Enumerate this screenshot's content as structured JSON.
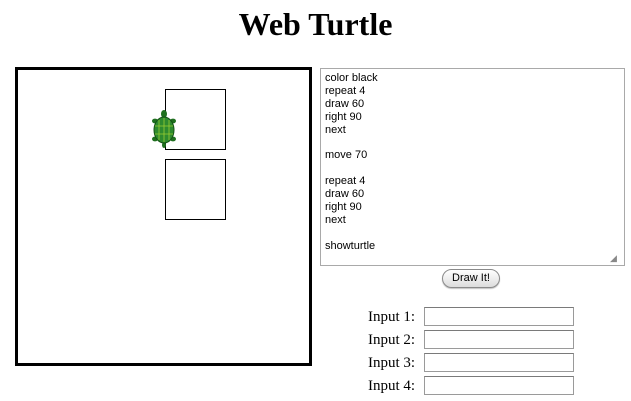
{
  "page": {
    "title": "Web Turtle"
  },
  "editor": {
    "code": "color black\nrepeat 4\ndraw 60\nright 90\nnext\n\nmove 70\n\nrepeat 4\ndraw 60\nright 90\nnext\n\nshowturtle"
  },
  "draw_button": {
    "label": "Draw It!"
  },
  "inputs": [
    {
      "label": "Input 1:",
      "value": ""
    },
    {
      "label": "Input 2:",
      "value": ""
    },
    {
      "label": "Input 3:",
      "value": ""
    },
    {
      "label": "Input 4:",
      "value": ""
    }
  ],
  "colors": {
    "turtle_shell": "#2e8b2e",
    "turtle_body": "#1f6f1f",
    "stroke": "#000000"
  }
}
